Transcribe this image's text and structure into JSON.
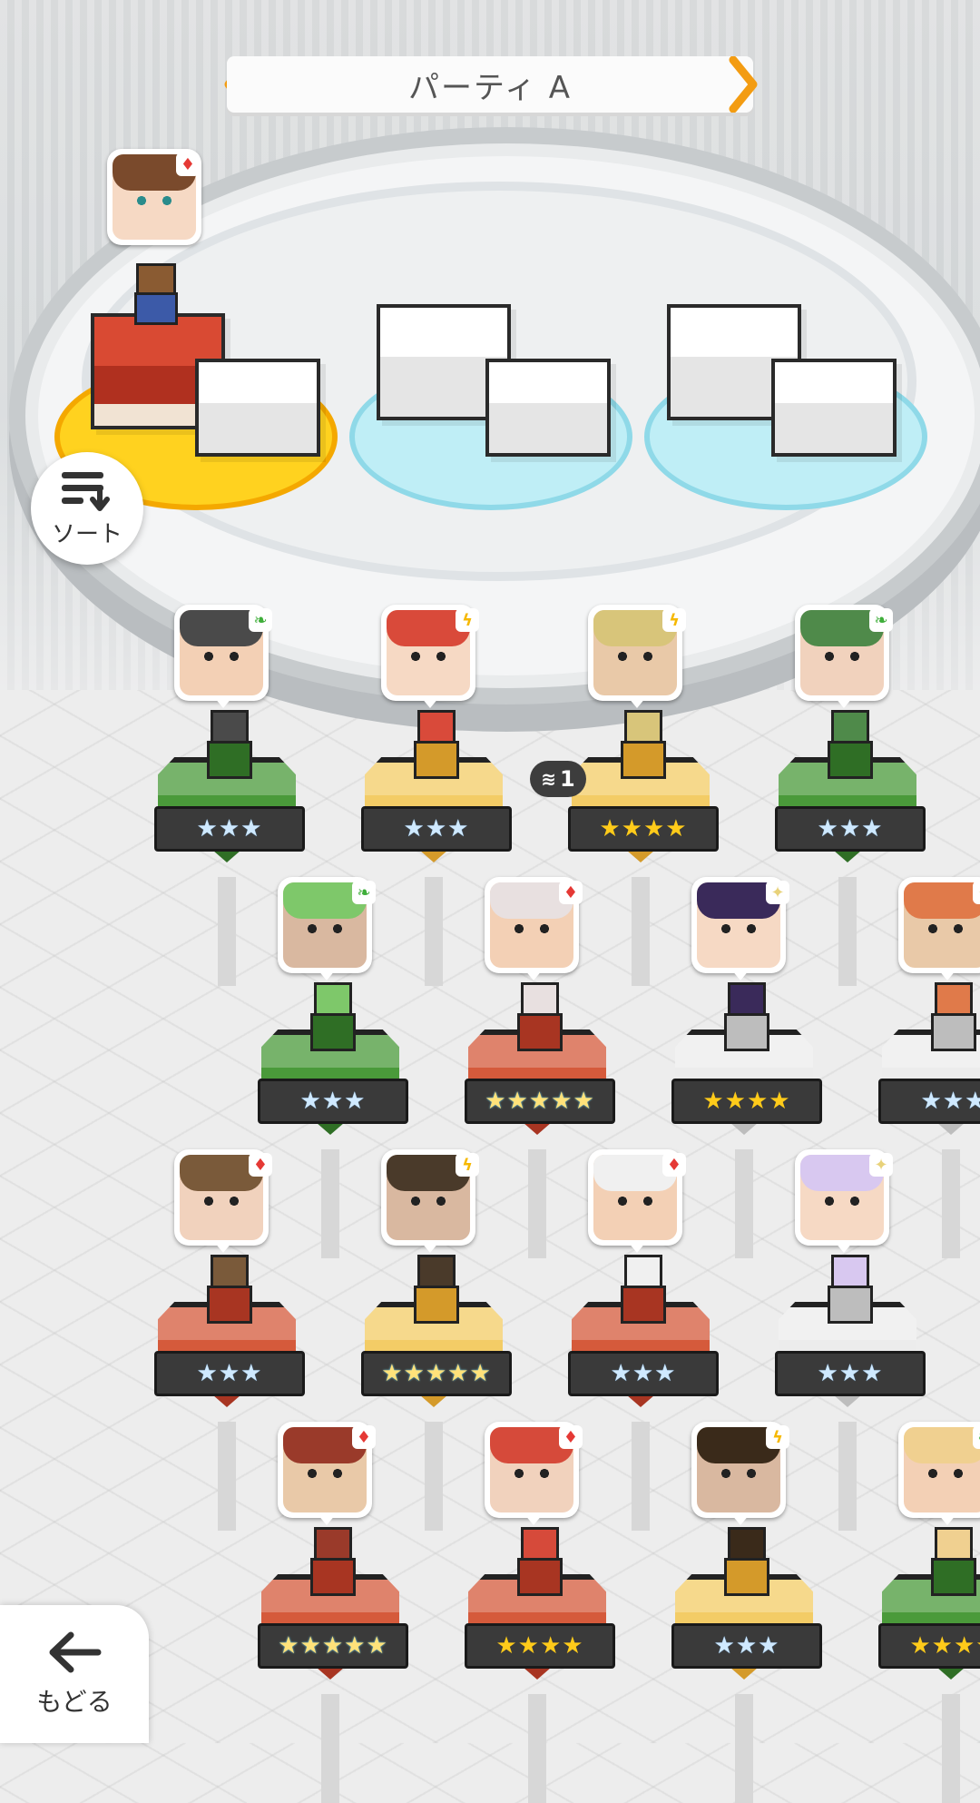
{
  "header": {
    "party_name": "パーティ A"
  },
  "buttons": {
    "sort_label": "ソート",
    "back_label": "もどる"
  },
  "colors": {
    "fire": "#e53935",
    "electric": "#f6b800",
    "wind": "#3fae3a",
    "light": "#e8d27a",
    "pedestal_green": "#3d8a31",
    "pedestal_gold": "#efc251",
    "pedestal_red": "#c84a32",
    "pedestal_white": "#e2e2e2"
  },
  "leader": {
    "element": "fire",
    "pedestal": "red"
  },
  "dupe_badge": {
    "count": "1"
  },
  "units": [
    {
      "element": "wind",
      "pedestal": "green",
      "stars": "★★★",
      "star_style": "blue"
    },
    {
      "element": "electric",
      "pedestal": "gold",
      "stars": "★★★",
      "star_style": "blue"
    },
    {
      "element": "electric",
      "pedestal": "gold",
      "stars": "★★★★",
      "star_style": "gold"
    },
    {
      "element": "wind",
      "pedestal": "green",
      "stars": "★★★",
      "star_style": "blue"
    },
    {
      "element": "wind",
      "pedestal": "green",
      "stars": "★★★",
      "star_style": "blue"
    },
    {
      "element": "fire",
      "pedestal": "red",
      "stars": "★★★★★",
      "star_style": "rainbow"
    },
    {
      "element": "light",
      "pedestal": "white",
      "stars": "★★★★",
      "star_style": "gold"
    },
    {
      "element": "light",
      "pedestal": "white",
      "stars": "★★★",
      "star_style": "blue"
    },
    {
      "element": "fire",
      "pedestal": "red",
      "stars": "★★★",
      "star_style": "blue"
    },
    {
      "element": "electric",
      "pedestal": "gold",
      "stars": "★★★★★",
      "star_style": "rainbow"
    },
    {
      "element": "fire",
      "pedestal": "red",
      "stars": "★★★",
      "star_style": "blue"
    },
    {
      "element": "light",
      "pedestal": "white",
      "stars": "★★★",
      "star_style": "blue"
    },
    {
      "element": "fire",
      "pedestal": "red",
      "stars": "★★★★★",
      "star_style": "rainbow"
    },
    {
      "element": "fire",
      "pedestal": "red",
      "stars": "★★★★",
      "star_style": "gold"
    },
    {
      "element": "electric",
      "pedestal": "gold",
      "stars": "★★★",
      "star_style": "blue"
    },
    {
      "element": "wind",
      "pedestal": "green",
      "stars": "★★★★",
      "star_style": "gold"
    }
  ]
}
